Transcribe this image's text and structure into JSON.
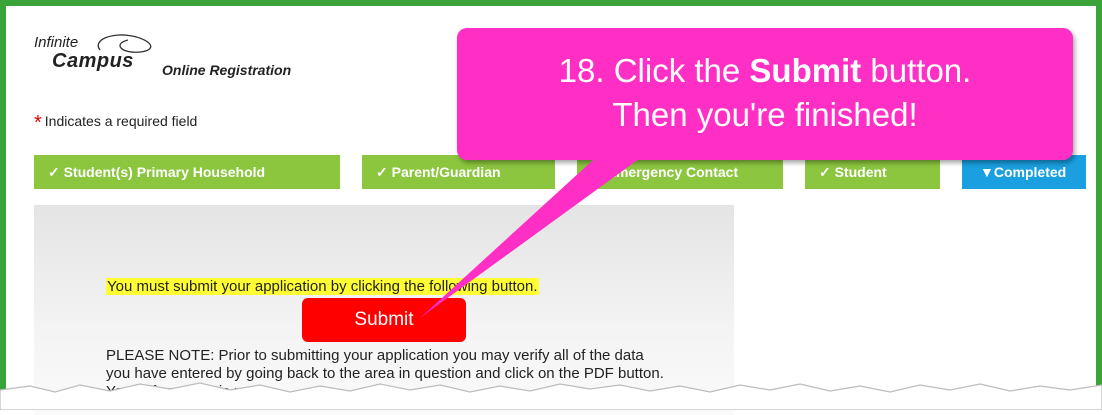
{
  "header": {
    "logo_line1": "Infinite",
    "logo_line2": "Campus",
    "title": "Online Registration"
  },
  "required_note": {
    "asterisk": "*",
    "text": "Indicates a required field"
  },
  "steps": [
    {
      "label": "✓ Student(s) Primary Household",
      "state": "done"
    },
    {
      "label": "✓ Parent/Guardian",
      "state": "done"
    },
    {
      "label": "✓ Emergency Contact",
      "state": "done"
    },
    {
      "label": "✓ Student",
      "state": "done"
    },
    {
      "label": "▼Completed",
      "state": "active"
    }
  ],
  "content": {
    "notice": "You must submit your application by clicking the following button.",
    "submit_label": "Submit",
    "note": "PLEASE NOTE: Prior to submitting your application you may verify all of the data you have entered by going back to the area in question and click on the PDF button. Your information is not."
  },
  "callout": {
    "line1_prefix": "18. Click the ",
    "line1_bold": "Submit",
    "line1_suffix": " button.",
    "line2": "Then you're finished!"
  },
  "colors": {
    "frame": "#3aa43a",
    "step_done": "#8cc63f",
    "step_active": "#1a9fe0",
    "callout": "#ff2ec4",
    "submit": "#ff0000",
    "highlight": "#ffff33"
  }
}
